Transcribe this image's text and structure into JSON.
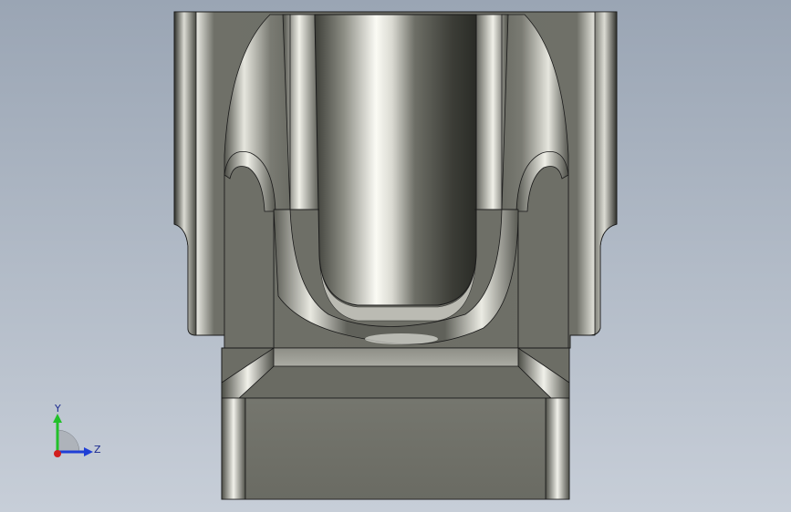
{
  "viewport": {
    "model": "housing-cross-section-part",
    "background_top": "#9aa5b4",
    "background_bottom": "#c7ced8",
    "body_color": "#6f7068",
    "highlight_color": "#f2f2ec",
    "edge_color": "#1a1a1a"
  },
  "triad": {
    "y_label": "Y",
    "z_label": "Z",
    "y_color": "#22c02a",
    "z_color": "#1f3fd6",
    "x_color": "#d21e1e"
  }
}
